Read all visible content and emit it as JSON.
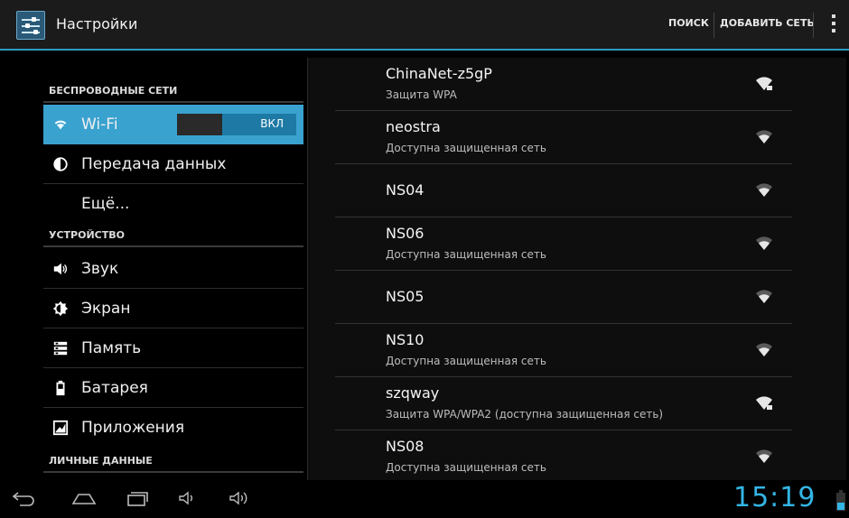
{
  "actionbar": {
    "title": "Настройки",
    "search_label": "ПОИСК",
    "add_network_label": "ДОБАВИТЬ СЕТЬ"
  },
  "settings": {
    "wireless_header": "БЕСПРОВОДНЫЕ СЕТИ",
    "wifi_label": "Wi-Fi",
    "wifi_toggle": "ВКЛ",
    "data_usage_label": "Передача данных",
    "more_label": "Ещё...",
    "device_header": "УСТРОЙСТВО",
    "sound_label": "Звук",
    "display_label": "Экран",
    "storage_label": "Память",
    "battery_label": "Батарея",
    "apps_label": "Приложения",
    "personal_header": "ЛИЧНЫЕ ДАННЫЕ"
  },
  "networks": [
    {
      "name": "ChinaNet-z5gP",
      "status": "Защита WPA"
    },
    {
      "name": "neostra",
      "status": "Доступна защищенная сеть"
    },
    {
      "name": "NS04",
      "status": ""
    },
    {
      "name": "NS06",
      "status": "Доступна защищенная сеть"
    },
    {
      "name": "NS05",
      "status": ""
    },
    {
      "name": "NS10",
      "status": "Доступна защищенная сеть"
    },
    {
      "name": "szqway",
      "status": "Защита WPA/WPA2 (доступна защищенная сеть)"
    },
    {
      "name": "NS08",
      "status": "Доступна защищенная сеть"
    }
  ],
  "statusbar": {
    "clock": "15:19"
  },
  "colors": {
    "accent": "#33b5e5",
    "selected": "#3aa2cf"
  }
}
